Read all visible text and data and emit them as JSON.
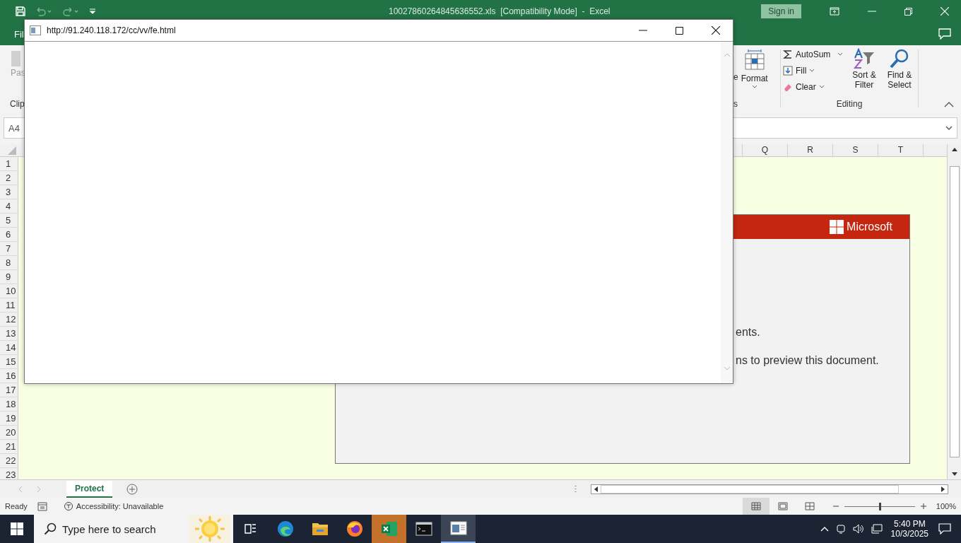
{
  "excel": {
    "title": "10027860264845636552.xls  [Compatibility Mode]  -  Excel",
    "sign_in": "Sign in",
    "menu_tab": "Fil",
    "ribbon": {
      "clipboard_button": "Pas",
      "clipboard_group": "Clip",
      "cells_button": "e",
      "format_button": "Format",
      "cells_group": "s",
      "editing": {
        "autosum": "AutoSum",
        "fill": "Fill",
        "clear": "Clear",
        "sort": [
          "Sort &",
          "Filter"
        ],
        "find": [
          "Find &",
          "Select"
        ],
        "group": "Editing"
      }
    },
    "name_box": "A4",
    "columns": [
      "Q",
      "R",
      "S",
      "T"
    ],
    "rows": [
      "1",
      "2",
      "3",
      "4",
      "5",
      "6",
      "7",
      "8",
      "9",
      "10",
      "11",
      "12",
      "13",
      "14",
      "15",
      "16",
      "17",
      "18",
      "19",
      "20",
      "21",
      "22",
      "23"
    ],
    "document": {
      "brand": "Microsoft",
      "lines": [
        "ents.",
        "ns to preview this document."
      ]
    },
    "sheet_tabs": [
      {
        "label": "Protect",
        "selected": true
      }
    ],
    "status_bar": {
      "mode": "Ready",
      "accessibility": "Accessibility: Unavailable",
      "views": [
        {
          "kind": "normal",
          "selected": true
        },
        {
          "kind": "page_layout",
          "selected": false
        },
        {
          "kind": "page_break",
          "selected": false
        }
      ],
      "zoom": {
        "level": 0.5,
        "reading": "100%"
      }
    }
  },
  "popup": {
    "url": "http://91.240.118.172/cc/vv/fe.html"
  },
  "taskbar": {
    "search_placeholder": "Type here to search",
    "apps": [
      {
        "kind": "task_view",
        "selected": false,
        "flashing": false
      },
      {
        "kind": "edge",
        "selected": false,
        "flashing": false
      },
      {
        "kind": "explorer",
        "selected": false,
        "flashing": false
      },
      {
        "kind": "firefox",
        "selected": false,
        "flashing": false
      },
      {
        "kind": "excel",
        "selected": false,
        "flashing": true
      },
      {
        "kind": "terminal",
        "selected": false,
        "flashing": false
      },
      {
        "kind": "window_app",
        "selected": true,
        "flashing": false
      }
    ],
    "time": "5:40 PM",
    "date": "10/3/2025"
  }
}
